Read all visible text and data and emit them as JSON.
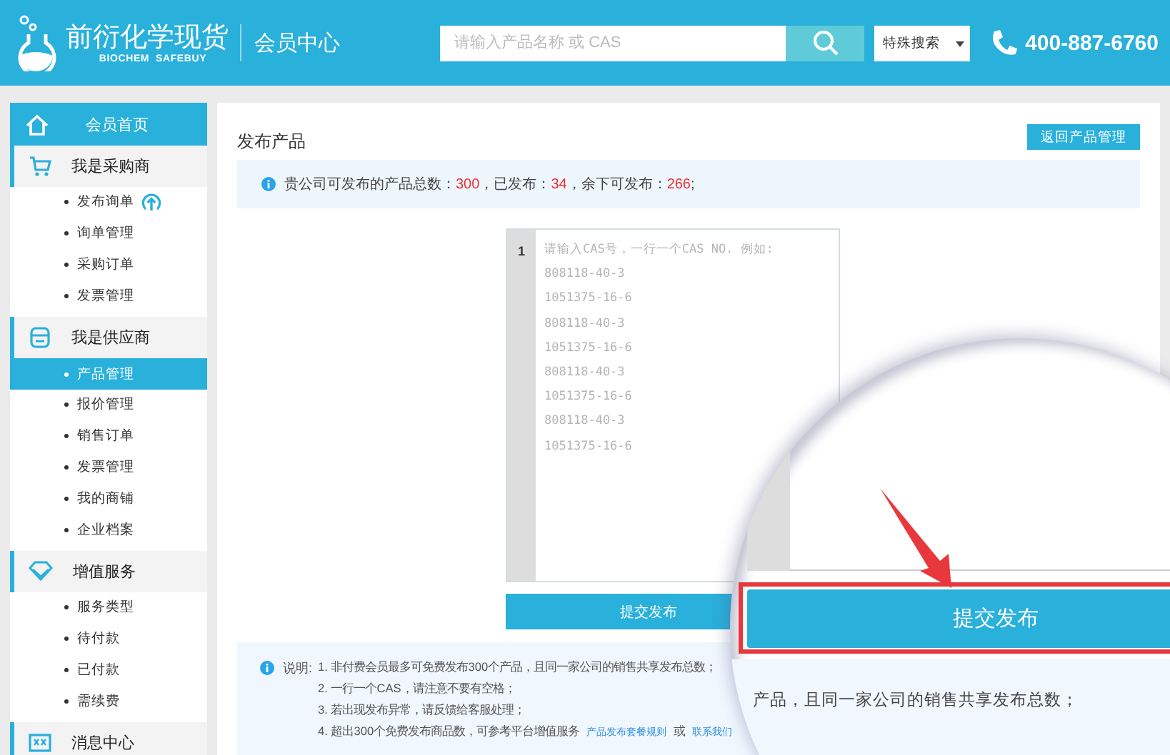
{
  "header": {
    "logo_title": "前衍化学现货",
    "logo_subtitle": "BIOCHEM  SAFEBUY",
    "section_title": "会员中心",
    "search": {
      "placeholder": "请输入产品名称 或 CAS"
    },
    "search_select": "特殊搜索",
    "phone": "400-887-6760"
  },
  "sidebar": {
    "home": {
      "label": "会员首页",
      "selected": true
    },
    "sections": [
      {
        "title": "我是采购商",
        "items": [
          {
            "label": "发布询单",
            "selected": false,
            "kind": "upload"
          },
          {
            "label": "询单管理",
            "selected": false,
            "kind": "plain"
          },
          {
            "label": "采购订单",
            "selected": false,
            "kind": "plain"
          },
          {
            "label": "发票管理",
            "selected": false,
            "kind": "plain"
          }
        ]
      },
      {
        "title": "我是供应商",
        "items": [
          {
            "label": "产品管理",
            "selected": true,
            "kind": "plain"
          },
          {
            "label": "报价管理",
            "selected": false,
            "kind": "plain"
          },
          {
            "label": "销售订单",
            "selected": false,
            "kind": "plain"
          },
          {
            "label": "发票管理",
            "selected": false,
            "kind": "plain"
          },
          {
            "label": "我的商铺",
            "selected": false,
            "kind": "plain"
          },
          {
            "label": "企业档案",
            "selected": false,
            "kind": "plain"
          }
        ]
      },
      {
        "title": "增值服务",
        "items": [
          {
            "label": "服务类型",
            "selected": false,
            "kind": "plain"
          },
          {
            "label": "待付款",
            "selected": false,
            "kind": "plain"
          },
          {
            "label": "已付款",
            "selected": false,
            "kind": "plain"
          },
          {
            "label": "需续费",
            "selected": false,
            "kind": "plain"
          }
        ]
      },
      {
        "title": "消息中心"
      }
    ]
  },
  "page": {
    "title": "发布产品",
    "back_button": "返回产品管理",
    "quota": [
      {
        "kind": "text",
        "text": "贵公司可发布的产品总数："
      },
      {
        "kind": "number",
        "text": "300"
      },
      {
        "kind": "text",
        "text": "，已发布："
      },
      {
        "kind": "number",
        "text": "34"
      },
      {
        "kind": "text",
        "text": "，余下可发布："
      },
      {
        "kind": "number",
        "text": "266"
      },
      {
        "kind": "text",
        "text": ";"
      }
    ],
    "editor": {
      "line_number": "1",
      "placeholder": [
        "请输入CAS号，一行一个CAS NO. 例如:",
        "808118-40-3",
        "1051375-16-6",
        "808118-40-3",
        "1051375-16-6",
        "808118-40-3",
        "1051375-16-6",
        "808118-40-3",
        "1051375-16-6"
      ]
    },
    "submit_button": "提交发布",
    "notes": {
      "label": "说明:",
      "lines": [
        [
          {
            "kind": "text",
            "text": "1. 非付费会员最多可免费发布300个产品，且同一家公司的销售共享发布总数；"
          }
        ],
        [
          {
            "kind": "text",
            "text": "2. 一行一个CAS，请注意不要有空格；"
          }
        ],
        [
          {
            "kind": "text",
            "text": "3. 若出现发布异常，请反馈给客服处理；"
          }
        ],
        [
          {
            "kind": "text",
            "text": "4. 超出300个免费发布商品数，可参考平台增值服务"
          },
          {
            "kind": "link",
            "text": "产品发布套餐规则"
          },
          {
            "kind": "text",
            "text": "或"
          },
          {
            "kind": "link",
            "text": "联系我们"
          }
        ]
      ]
    }
  },
  "magnifier": {
    "button": "提交发布",
    "note_fragment": "产品，且同一家公司的销售共享发布总数；"
  }
}
